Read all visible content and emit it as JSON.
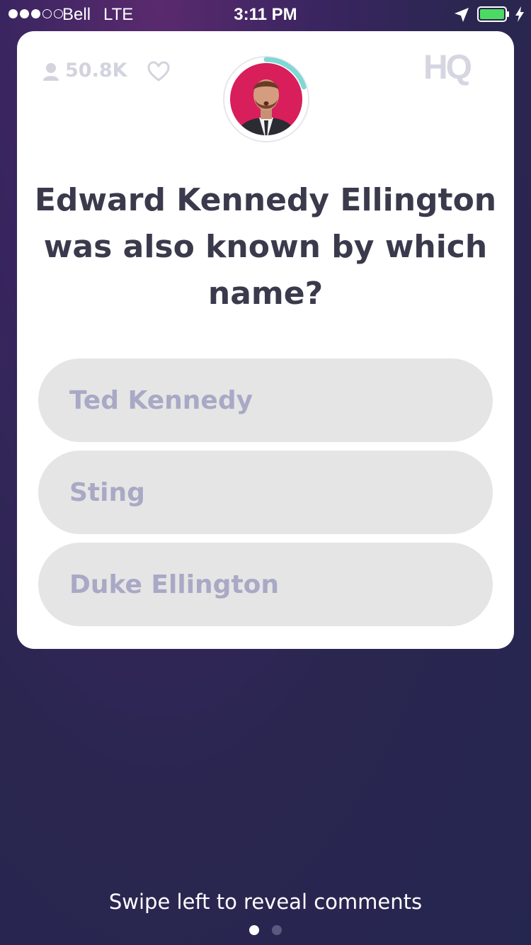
{
  "status_bar": {
    "carrier": "Bell",
    "network": "LTE",
    "time": "3:11 PM",
    "signal_bars": 3,
    "signal_total": 5
  },
  "header": {
    "viewer_count": "50.8K",
    "logo": "HQ",
    "timer_progress": 0.2
  },
  "question": "Edward Kennedy Ellington was also known by which name?",
  "answers": [
    {
      "label": "Ted Kennedy"
    },
    {
      "label": "Sting"
    },
    {
      "label": "Duke Ellington"
    }
  ],
  "footer": {
    "hint": "Swipe left to reveal comments",
    "page_count": 2,
    "active_page": 0
  },
  "colors": {
    "timer": "#7fd8d4",
    "avatar_bg": "#d81e5b",
    "battery": "#4cd964"
  },
  "icons": [
    "user-icon",
    "heart-icon",
    "location-arrow-icon",
    "battery-icon",
    "charging-bolt-icon"
  ]
}
